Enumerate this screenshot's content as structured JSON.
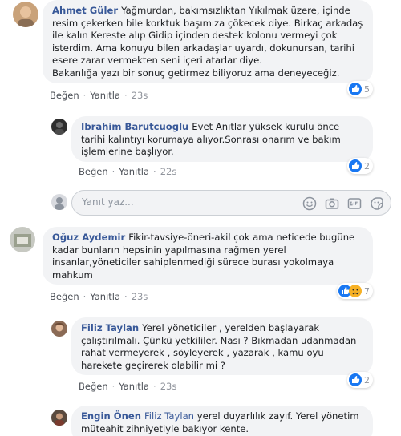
{
  "comments": [
    {
      "author": "Ahmet Güler",
      "text": "Yağmurdan, bakımsızlıktan Yıkılmak üzere, içinde resim çekerken bile korktuk başımıza çökecek diye. Birkaç arkadaş ile kalın Kereste alıp Gidip içinden destek kolonu vermeyi çok isterdim. Ama konuyu bilen arkadaşlar uyardı, dokunursan, tarihi esere zarar vermekten seni içeri atarlar diye.",
      "text2": "Bakanlığa yazı bir sonuç getirmez biliyoruz ama deneyeceğiz.",
      "like": "Beğen",
      "reply": "Yanıtla",
      "time": "23s",
      "reactions": "5"
    },
    {
      "author": "Ibrahim Barutcuoglu",
      "text": "Evet Anıtlar yüksek kurulu önce tarihi kalıntıyı korumaya alıyor.Sonrası onarım ve bakım işlemlerine başlıyor.",
      "like": "Beğen",
      "reply": "Yanıtla",
      "time": "22s",
      "reactions": "2"
    },
    {
      "author": "Oğuz Aydemir",
      "text": "Fikir-tavsiye-öneri-akil çok ama neticede bugüne kadar bunların hepsinin yapılmasına rağmen yerel insanlar,yöneticiler sahiplenmediği sürece burası yokolmaya mahkum",
      "like": "Beğen",
      "reply": "Yanıtla",
      "time": "23s",
      "reactions": "7"
    },
    {
      "author": "Filiz Taylan",
      "text": "Yerel yöneticiler , yerelden başlayarak çalıştırılmalı. Çünkü yetkililer. Nası ? Bıkmadan udanmadan rahat vermeyerek , söyleyerek , yazarak , kamu oyu harekete geçirerek olabilir mi ?",
      "like": "Beğen",
      "reply": "Yanıtla",
      "time": "23s",
      "reactions": "2"
    },
    {
      "author": "Engin Önen",
      "mention": "Filiz Taylan",
      "text": "yerel duyarlılık zayıf. Yerel yönetim müteahit zihniyetiyle bakıyor kente."
    }
  ],
  "reply_box": {
    "placeholder": "Yanıt yaz..."
  },
  "colors": {
    "link": "#385898",
    "bubble": "#f2f3f5",
    "like_blue": "#1877f2",
    "sad_yellow": "#f7b125"
  },
  "icons": [
    "like-icon",
    "sad-icon",
    "emoji-icon",
    "camera-icon",
    "gif-icon",
    "sticker-icon"
  ]
}
